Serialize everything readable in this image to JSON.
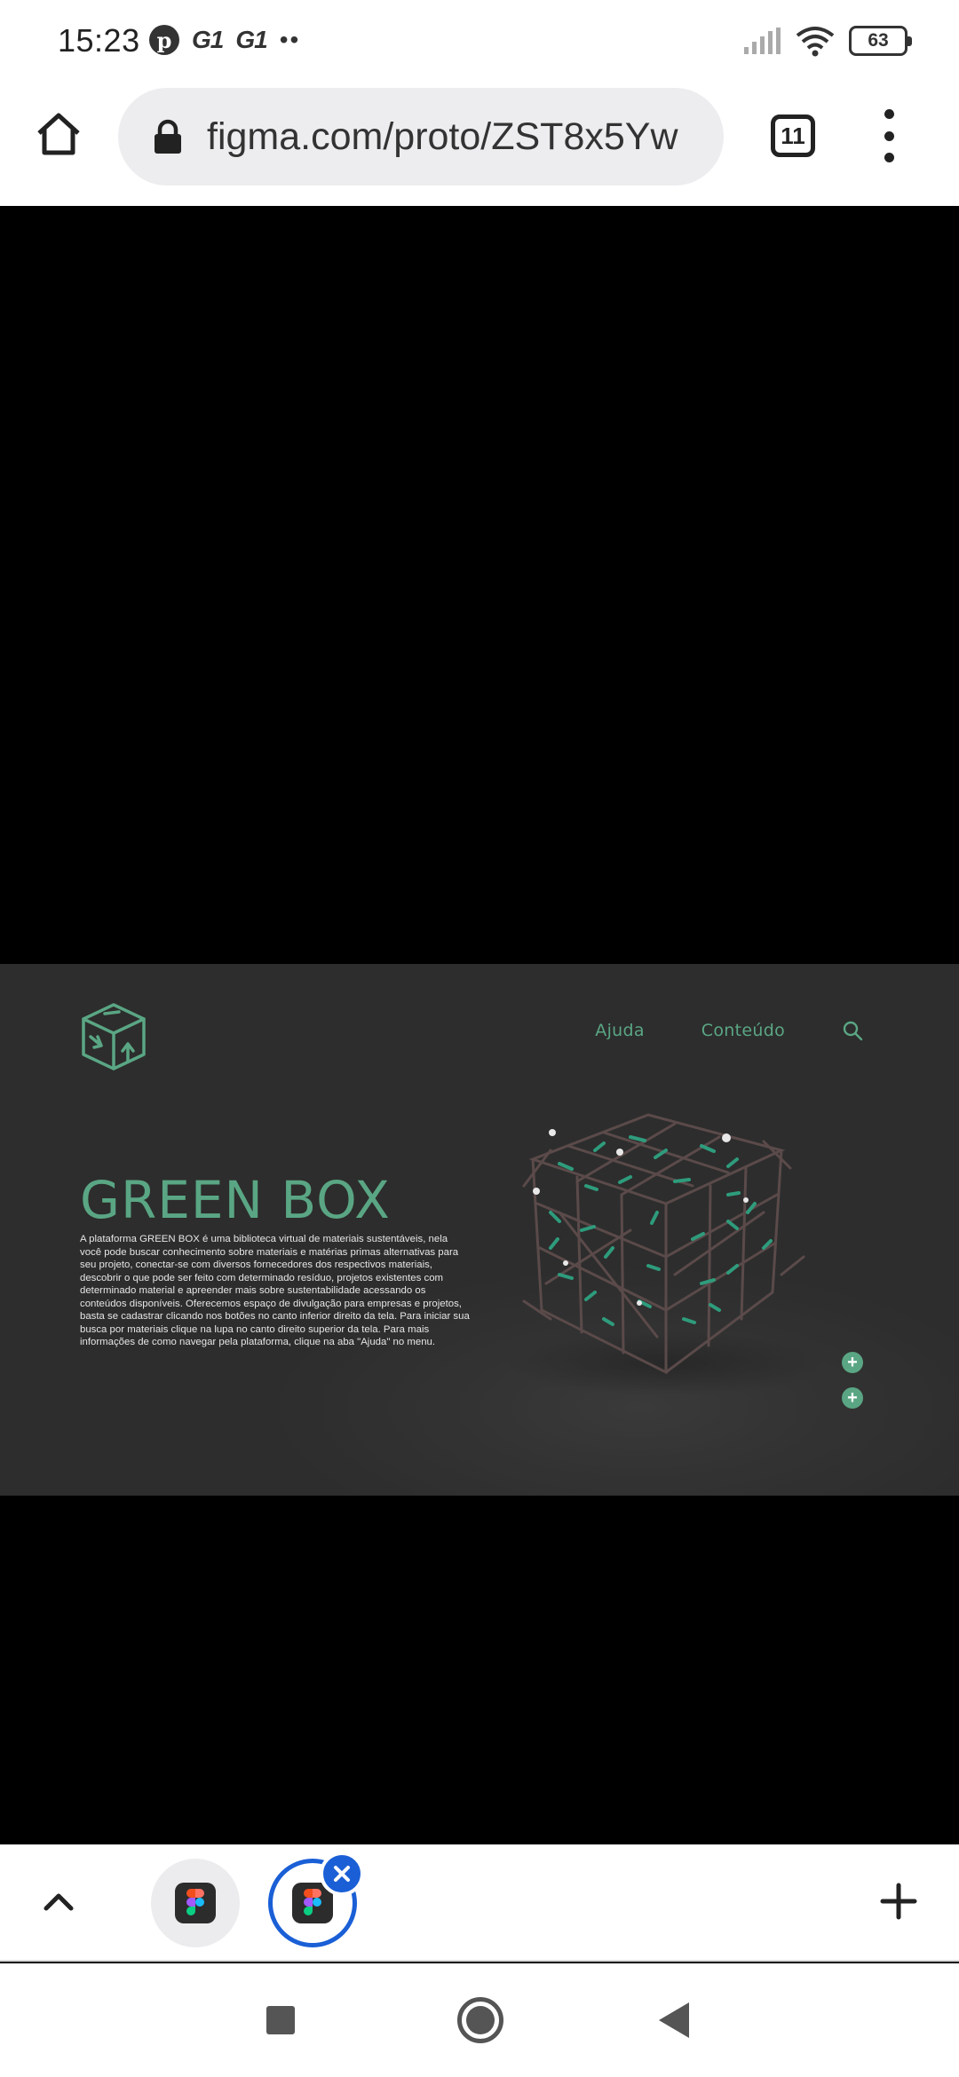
{
  "status_bar": {
    "time": "15:23",
    "notifications": [
      "pinterest-icon",
      "g1",
      "g1"
    ],
    "notif_g1_a": "G1",
    "notif_g1_b": "G1",
    "more_dots": "••",
    "battery": "63"
  },
  "browser": {
    "url": "figma.com/proto/ZST8x5Yw",
    "tab_count": "11"
  },
  "frame": {
    "nav": {
      "help": "Ajuda",
      "content": "Conteúdo"
    },
    "title": "GREEN BOX",
    "description": "A plataforma GREEN BOX é uma biblioteca virtual de materiais sustentáveis, nela você pode buscar conhecimento sobre materiais e matérias primas alternativas para seu projeto, conectar-se com diversos fornecedores dos respectivos materiais, descobrir o que pode ser feito com determinado resíduo, projetos existentes com determinado material e apreender mais sobre sustentabilidade acessando os conteúdos disponíveis. Oferecemos espaço de divulgação para empresas e projetos, basta se cadastrar clicando nos botões no canto inferior direito da tela. Para iniciar sua busca por materiais clique na lupa no canto direito superior da tela. Para mais informações de como navegar pela plataforma, clique na aba \"Ajuda\" no menu.",
    "plus_label": "+",
    "accent": "#5aa684",
    "background": "#2f2f2f"
  },
  "tab_strip": {
    "tabs": [
      "figma-tab",
      "figma-tab-active"
    ]
  }
}
